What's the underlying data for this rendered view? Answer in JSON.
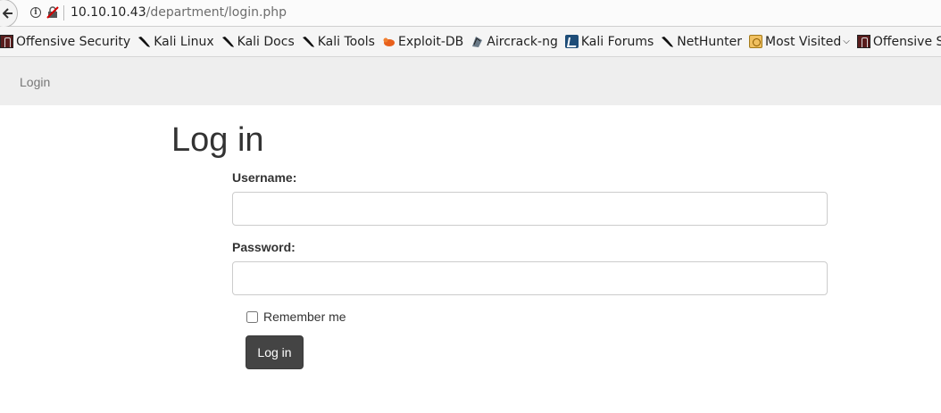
{
  "browser": {
    "url_host": "10.10.10.43",
    "url_path": "/department/login.php"
  },
  "bookmarks": [
    {
      "label": "Offensive Security",
      "icon": "offensive-security-icon"
    },
    {
      "label": "Kali Linux",
      "icon": "kali-dragon-icon"
    },
    {
      "label": "Kali Docs",
      "icon": "kali-dragon-icon"
    },
    {
      "label": "Kali Tools",
      "icon": "kali-dragon-icon"
    },
    {
      "label": "Exploit-DB",
      "icon": "exploit-db-icon"
    },
    {
      "label": "Aircrack-ng",
      "icon": "aircrack-icon"
    },
    {
      "label": "Kali Forums",
      "icon": "kali-forums-icon"
    },
    {
      "label": "NetHunter",
      "icon": "kali-dragon-icon"
    },
    {
      "label": "Most Visited",
      "icon": "folder-icon"
    },
    {
      "label": "Offensive Security",
      "icon": "offensive-security-icon"
    }
  ],
  "navbar": {
    "login_link": "Login"
  },
  "form": {
    "title": "Log in",
    "username_label": "Username:",
    "username_value": "",
    "password_label": "Password:",
    "password_value": "",
    "remember_label": "Remember me",
    "remember_checked": false,
    "submit_label": "Log in"
  }
}
